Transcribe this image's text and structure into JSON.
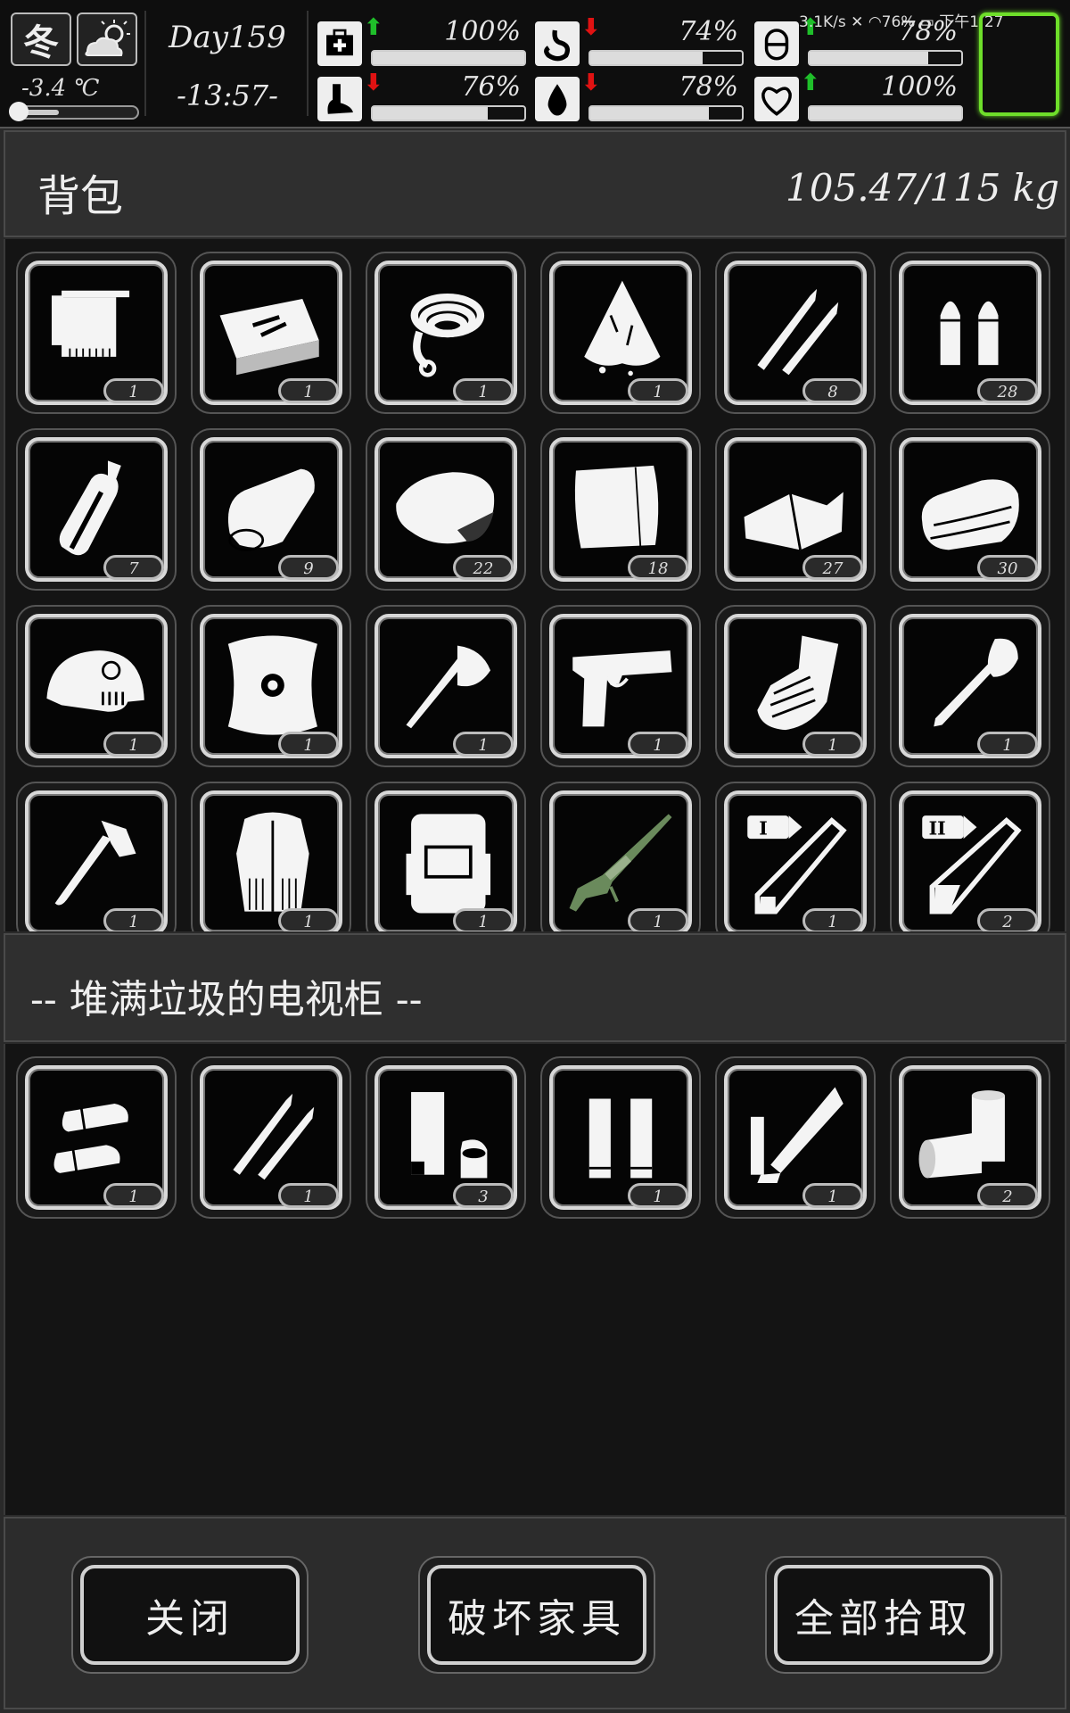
{
  "hud": {
    "season": "冬",
    "temperature": "-3.4 ℃",
    "temperature_level": 0.35,
    "day": "Day159",
    "time": "-13:57-",
    "stats": [
      {
        "name": "health",
        "icon": "medkit-icon",
        "trend": "up",
        "percent": "100%",
        "value": 100
      },
      {
        "name": "hunger",
        "icon": "stomach-icon",
        "trend": "down",
        "percent": "74%",
        "value": 74
      },
      {
        "name": "mood",
        "icon": "pill-icon",
        "trend": "up",
        "percent": "78%",
        "value": 78
      },
      {
        "name": "stamina",
        "icon": "foot-icon",
        "trend": "down",
        "percent": "76%",
        "value": 76
      },
      {
        "name": "thirst",
        "icon": "water-drop-icon",
        "trend": "down",
        "percent": "78%",
        "value": 78
      },
      {
        "name": "heart",
        "icon": "heart-icon",
        "trend": "up",
        "percent": "100%",
        "value": 100
      }
    ],
    "status_bar": "3.1K/s ✕ ◠76% ▭ 下午1:27"
  },
  "backpack": {
    "title": "背包",
    "weight": "105.47/115 kg",
    "items": [
      {
        "icon": "towel-icon",
        "count": "1"
      },
      {
        "icon": "toolbox-icon",
        "count": "1"
      },
      {
        "icon": "rope-icon",
        "count": "1"
      },
      {
        "icon": "bloody-cloth-icon",
        "count": "1"
      },
      {
        "icon": "rifle-bullets-icon",
        "count": "8"
      },
      {
        "icon": "pistol-bullets-icon",
        "count": "28"
      },
      {
        "icon": "bottle-icon",
        "count": "7"
      },
      {
        "icon": "cloth-roll-icon",
        "count": "9"
      },
      {
        "icon": "raw-meat-icon",
        "count": "22"
      },
      {
        "icon": "paper-sheets-icon",
        "count": "18"
      },
      {
        "icon": "fabric-pieces-icon",
        "count": "27"
      },
      {
        "icon": "folded-cloth-icon",
        "count": "30"
      },
      {
        "icon": "helmet-icon",
        "count": "1"
      },
      {
        "icon": "shield-icon",
        "count": "1"
      },
      {
        "icon": "axe-icon",
        "count": "1"
      },
      {
        "icon": "pistol-icon",
        "count": "1"
      },
      {
        "icon": "gauntlet-icon",
        "count": "1"
      },
      {
        "icon": "shovel-icon",
        "count": "1"
      },
      {
        "icon": "hammer-axe-icon",
        "count": "1"
      },
      {
        "icon": "fur-coat-icon",
        "count": "1"
      },
      {
        "icon": "military-backpack-icon",
        "count": "1"
      },
      {
        "icon": "sniper-rifle-icon",
        "count": "1"
      },
      {
        "icon": "syringe-level-1-icon",
        "count": "1"
      },
      {
        "icon": "syringe-level-2-icon",
        "count": "2"
      }
    ]
  },
  "container": {
    "title": "-- 堆满垃圾的电视柜 --",
    "items": [
      {
        "icon": "shotgun-shells-icon",
        "count": "1"
      },
      {
        "icon": "rifle-bullets-icon",
        "count": "1"
      },
      {
        "icon": "shell-casing-icon",
        "count": "3"
      },
      {
        "icon": "long-cartridges-icon",
        "count": "1"
      },
      {
        "icon": "rocket-ammo-icon",
        "count": "1"
      },
      {
        "icon": "large-shells-icon",
        "count": "2"
      }
    ]
  },
  "buttons": {
    "close": "关闭",
    "destroy": "破坏家具",
    "take_all": "全部拾取"
  },
  "colors": {
    "hud_bg": "#0e0e0e",
    "panel_bg": "#2f2f2f",
    "slot_border": "#d8d8d8",
    "trend_up": "#1fbf2a",
    "trend_down": "#e01212",
    "highlight": "#6ede2a"
  }
}
